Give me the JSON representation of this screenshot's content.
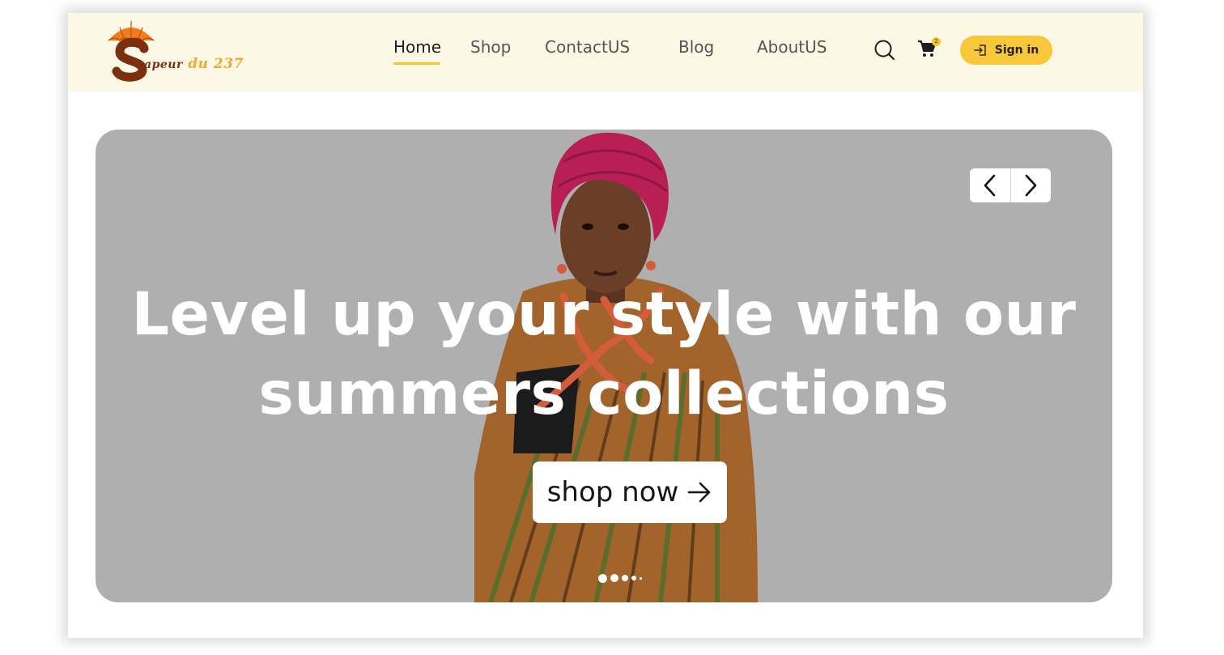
{
  "brand": {
    "logo_text": "Sapeur du 237",
    "logo_word": "apeur",
    "logo_suffix": "du 237"
  },
  "nav": {
    "items": [
      {
        "label": "Home",
        "active": true
      },
      {
        "label": "Shop",
        "active": false
      },
      {
        "label": "ContactUS",
        "active": false
      },
      {
        "label": "Blog",
        "active": false
      },
      {
        "label": "AboutUS",
        "active": false
      }
    ]
  },
  "header": {
    "search_icon": "search-icon",
    "cart_icon": "shopping-cart-icon",
    "cart_count": "2",
    "signin_icon": "sign-in-icon",
    "signin_label": "Sign in"
  },
  "hero": {
    "headline_line1": "Level up your style with our",
    "headline_line2": "summers collections",
    "cta_label": "shop now",
    "cta_icon": "arrow-right-icon",
    "prev_icon": "chevron-left-icon",
    "next_icon": "chevron-right-icon",
    "slide_count": 4,
    "active_slide": 1
  },
  "colors": {
    "header_bg": "#fdf7e6",
    "accent": "#f8c73a",
    "hero_bg": "#afafaf",
    "logo_brown": "#7a2f0e",
    "logo_orange": "#f07c1e"
  }
}
